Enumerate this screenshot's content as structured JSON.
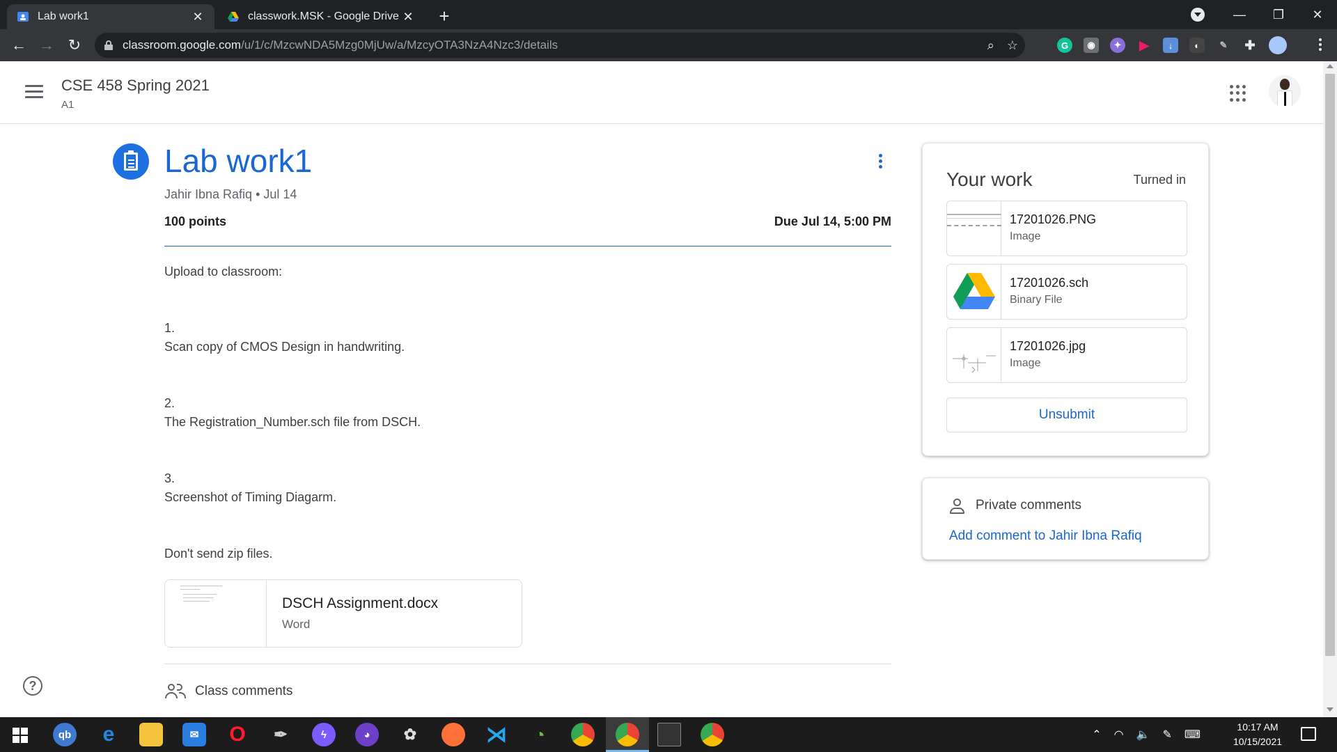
{
  "browser": {
    "tabs": [
      {
        "title": "Lab work1",
        "active": true
      },
      {
        "title": "classwork.MSK - Google Drive",
        "active": false
      }
    ],
    "url_host": "classroom.google.com",
    "url_path": "/u/1/c/MzcwNDA5Mzg0MjUw/a/MzcyOTA3NzA4Nzc3/details"
  },
  "header": {
    "course_title": "CSE 458 Spring 2021",
    "section": "A1"
  },
  "assignment": {
    "title": "Lab work1",
    "author": "Jahir Ibna Rafiq",
    "posted": "Jul 14",
    "points": "100 points",
    "due": "Due Jul 14, 5:00 PM",
    "description": {
      "intro": "Upload to classroom:",
      "item1_num": "1.",
      "item1_text": "Scan copy of CMOS Design in handwriting.",
      "item2_num": "2.",
      "item2_text": "The Registration_Number.sch file from DSCH.",
      "item3_num": "3.",
      "item3_text": "Screenshot of Timing Diagarm.",
      "note": "Don't send zip files."
    },
    "attachment": {
      "name": "DSCH Assignment.docx",
      "type": "Word"
    },
    "class_comments_label": "Class comments"
  },
  "your_work": {
    "title": "Your work",
    "status": "Turned in",
    "files": [
      {
        "name": "17201026.PNG",
        "type": "Image"
      },
      {
        "name": "17201026.sch",
        "type": "Binary File"
      },
      {
        "name": "17201026.jpg",
        "type": "Image"
      }
    ],
    "unsubmit_label": "Unsubmit"
  },
  "private_comments": {
    "title": "Private comments",
    "add_label": "Add comment to Jahir Ibna Rafiq"
  },
  "taskbar": {
    "time": "10:17 AM",
    "date": "10/15/2021"
  },
  "colors": {
    "accent": "#1967d2",
    "browser_dark": "#202124",
    "taskbar": "#1c1c1c"
  }
}
